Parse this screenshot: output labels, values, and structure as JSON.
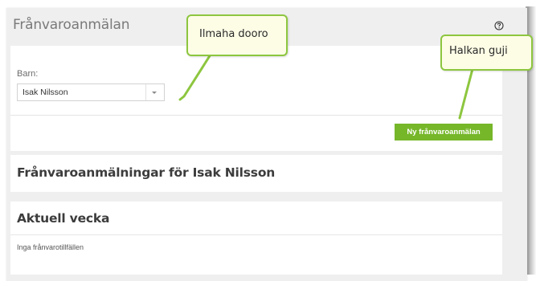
{
  "panel": {
    "title": "Frånvaroanmälan",
    "help_icon": "help-circle-icon"
  },
  "child_selector": {
    "label": "Barn:",
    "value": "Isak Nilsson",
    "caret_icon": "chevron-down-icon"
  },
  "actions": {
    "new_report_label": "Ny frånvaroanmälan"
  },
  "absences_section": {
    "title": "Frånvaroanmälningar för Isak Nilsson"
  },
  "current_week": {
    "title": "Aktuell vecka",
    "empty_text": "Inga frånvarotillfällen"
  },
  "annotations": [
    {
      "text": "Ilmaha dooro"
    },
    {
      "text": "Halkan guji"
    }
  ],
  "colors": {
    "accent_green": "#76b72a",
    "callout_border": "#8dc63f",
    "callout_fill": "#fdfde6"
  }
}
